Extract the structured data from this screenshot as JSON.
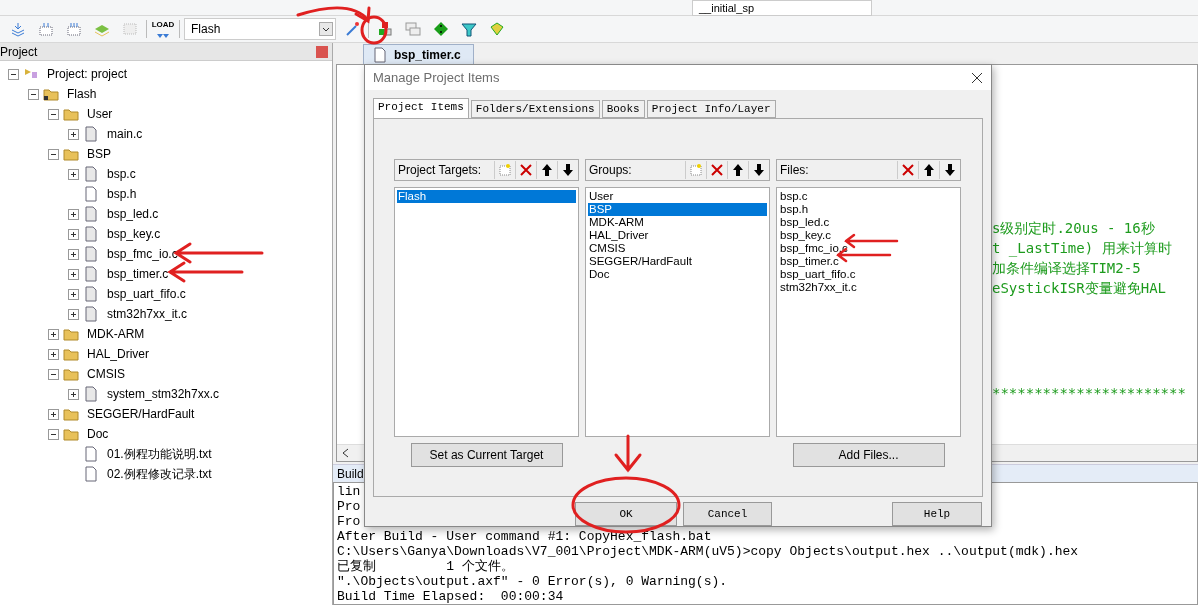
{
  "toolbar_top": {
    "symbol_combo": "__initial_sp"
  },
  "toolbar": {
    "load_label": "LOAD",
    "target_combo": "Flash"
  },
  "project_panel": {
    "title": "Project",
    "tree": [
      {
        "label": "Project: project",
        "kind": "project",
        "expanded": true,
        "children": [
          {
            "label": "Flash",
            "kind": "target",
            "expanded": true,
            "children": [
              {
                "label": "User",
                "kind": "group",
                "expanded": true,
                "children": [
                  {
                    "label": "main.c",
                    "kind": "file",
                    "expanded": false
                  }
                ]
              },
              {
                "label": "BSP",
                "kind": "group",
                "expanded": true,
                "children": [
                  {
                    "label": "bsp.c",
                    "kind": "file",
                    "expanded": false
                  },
                  {
                    "label": "bsp.h",
                    "kind": "header"
                  },
                  {
                    "label": "bsp_led.c",
                    "kind": "file",
                    "expanded": false
                  },
                  {
                    "label": "bsp_key.c",
                    "kind": "file",
                    "expanded": false
                  },
                  {
                    "label": "bsp_fmc_io.c",
                    "kind": "file",
                    "expanded": false
                  },
                  {
                    "label": "bsp_timer.c",
                    "kind": "file",
                    "expanded": false
                  },
                  {
                    "label": "bsp_uart_fifo.c",
                    "kind": "file",
                    "expanded": false
                  },
                  {
                    "label": "stm32h7xx_it.c",
                    "kind": "file",
                    "expanded": false
                  }
                ]
              },
              {
                "label": "MDK-ARM",
                "kind": "group",
                "expanded": false
              },
              {
                "label": "HAL_Driver",
                "kind": "group",
                "expanded": false
              },
              {
                "label": "CMSIS",
                "kind": "group",
                "expanded": true,
                "children": [
                  {
                    "label": "system_stm32h7xx.c",
                    "kind": "file",
                    "expanded": false
                  }
                ]
              },
              {
                "label": "SEGGER/HardFault",
                "kind": "group",
                "expanded": false
              },
              {
                "label": "Doc",
                "kind": "group",
                "expanded": true,
                "children": [
                  {
                    "label": "01.例程功能说明.txt",
                    "kind": "header"
                  },
                  {
                    "label": "02.例程修改记录.txt",
                    "kind": "header"
                  }
                ]
              }
            ]
          }
        ]
      }
    ]
  },
  "editor": {
    "tab": "bsp_timer.c",
    "code_lines": [
      "s级别定时.20us - 16秒",
      "t _LastTime) 用来计算时",
      "加条件编译选择TIM2-5",
      "eSystickISR变量避免HAL"
    ],
    "comment_rule": "***********************"
  },
  "build_output": {
    "title": "Build",
    "lines": [
      "lin",
      "Pro",
      "Fro",
      "After Build - User command #1: CopyHex_flash.bat",
      "C:\\Users\\Ganya\\Downloads\\V7_001\\Project\\MDK-ARM(uV5)>copy Objects\\output.hex ..\\output(mdk).hex",
      "已复制         1 个文件。",
      "\".\\Objects\\output.axf\" - 0 Error(s), 0 Warning(s).",
      "Build Time Elapsed:  00:00:34"
    ]
  },
  "dialog": {
    "title": "Manage Project Items",
    "tabs": [
      {
        "label": "Project Items",
        "selected": true
      },
      {
        "label": "Folders/Extensions",
        "selected": false
      },
      {
        "label": "Books",
        "selected": false
      },
      {
        "label": "Project Info/Layer",
        "selected": false
      }
    ],
    "lists": [
      {
        "title": "Project Targets:",
        "kind": "full",
        "items": [
          {
            "label": "Flash",
            "selected": true
          }
        ],
        "button": "Set as Current Target"
      },
      {
        "title": "Groups:",
        "kind": "full",
        "items": [
          {
            "label": "User",
            "selected": false
          },
          {
            "label": "BSP",
            "selected": true
          },
          {
            "label": "MDK-ARM",
            "selected": false
          },
          {
            "label": "HAL_Driver",
            "selected": false
          },
          {
            "label": "CMSIS",
            "selected": false
          },
          {
            "label": "SEGGER/HardFault",
            "selected": false
          },
          {
            "label": "Doc",
            "selected": false
          }
        ]
      },
      {
        "title": "Files:",
        "kind": "files",
        "items": [
          {
            "label": "bsp.c",
            "selected": false
          },
          {
            "label": "bsp.h",
            "selected": false
          },
          {
            "label": "bsp_led.c",
            "selected": false
          },
          {
            "label": "bsp_key.c",
            "selected": false
          },
          {
            "label": "bsp_fmc_io.c",
            "selected": false
          },
          {
            "label": "bsp_timer.c",
            "selected": false
          },
          {
            "label": "bsp_uart_fifo.c",
            "selected": false
          },
          {
            "label": "stm32h7xx_it.c",
            "selected": false
          }
        ],
        "button": "Add Files..."
      }
    ],
    "buttons": [
      "OK",
      "Cancel",
      "Help"
    ]
  }
}
